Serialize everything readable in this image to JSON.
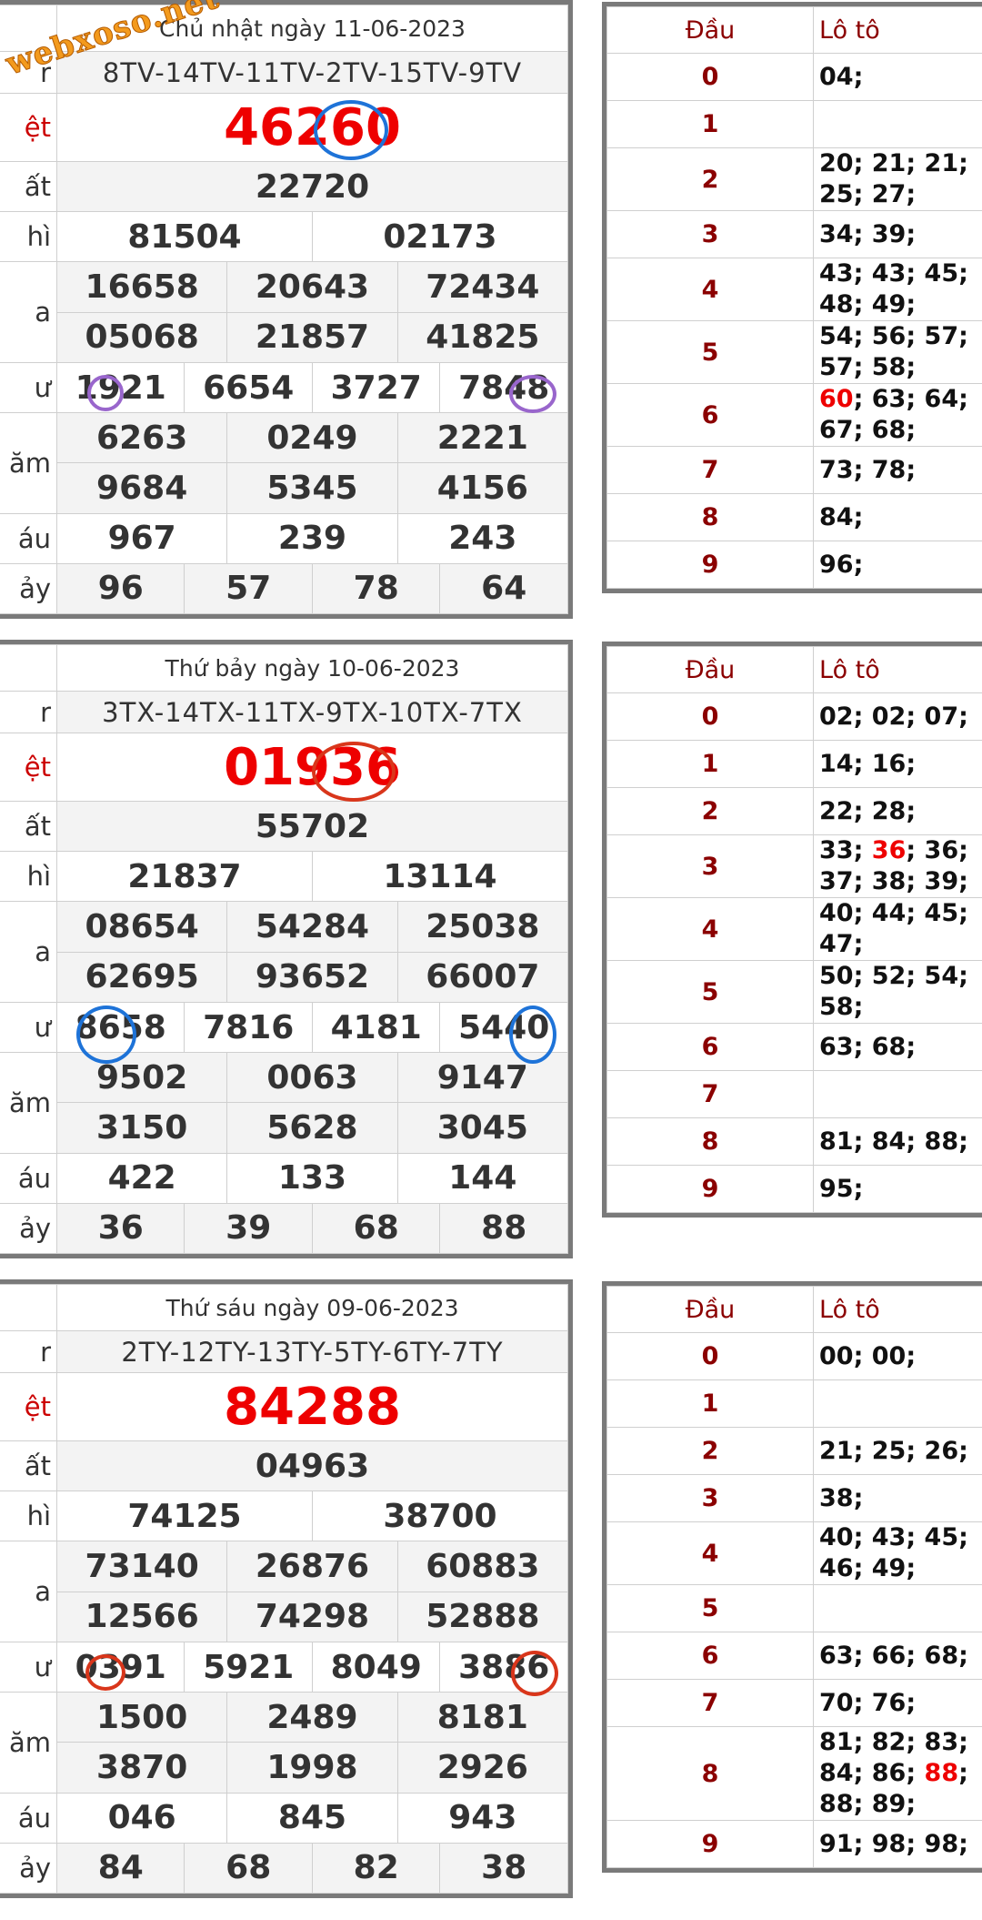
{
  "watermark": "webxoso.net",
  "draws": [
    {
      "date": "Chủ nhật ngày 11-06-2023",
      "labels": {
        "code": "r",
        "special": "ệt",
        "first": "ất",
        "second": "hì",
        "third": "a",
        "fourth": "ư",
        "fifth": "ăm",
        "sixth": "áu",
        "seventh": "ảy"
      },
      "code": "8TV-14TV-11TV-2TV-15TV-9TV",
      "special": "46260",
      "first": "22720",
      "second": [
        "81504",
        "02173"
      ],
      "third": [
        "16658",
        "20643",
        "72434",
        "05068",
        "21857",
        "41825"
      ],
      "fourth": [
        "1921",
        "6654",
        "3727",
        "7848"
      ],
      "fifth": [
        "6263",
        "0249",
        "2221",
        "9684",
        "5345",
        "4156"
      ],
      "sixth": [
        "967",
        "239",
        "243"
      ],
      "seventh": [
        "96",
        "57",
        "78",
        "64"
      ],
      "loto_header": {
        "dau": "Đầu",
        "loto": "Lô tô"
      },
      "loto": [
        {
          "d": "0",
          "v": "04;"
        },
        {
          "d": "1",
          "v": ""
        },
        {
          "d": "2",
          "v": "20; 21; 21; 25; 27;"
        },
        {
          "d": "3",
          "v": "34; 39;"
        },
        {
          "d": "4",
          "v": "43; 43; 45; 48; 49;"
        },
        {
          "d": "5",
          "v": "54; 56; 57; 57; 58;"
        },
        {
          "d": "6",
          "hl": "60",
          "v": "; 63; 64; 67; 68;"
        },
        {
          "d": "7",
          "v": "73; 78;"
        },
        {
          "d": "8",
          "v": "84;"
        },
        {
          "d": "9",
          "v": "96;"
        }
      ]
    },
    {
      "date": "Thứ bảy ngày 10-06-2023",
      "labels": {
        "code": "r",
        "special": "ệt",
        "first": "ất",
        "second": "hì",
        "third": "a",
        "fourth": "ư",
        "fifth": "ăm",
        "sixth": "áu",
        "seventh": "ảy"
      },
      "code": "3TX-14TX-11TX-9TX-10TX-7TX",
      "special": "01936",
      "first": "55702",
      "second": [
        "21837",
        "13114"
      ],
      "third": [
        "08654",
        "54284",
        "25038",
        "62695",
        "93652",
        "66007"
      ],
      "fourth": [
        "8658",
        "7816",
        "4181",
        "5440"
      ],
      "fifth": [
        "9502",
        "0063",
        "9147",
        "3150",
        "5628",
        "3045"
      ],
      "sixth": [
        "422",
        "133",
        "144"
      ],
      "seventh": [
        "36",
        "39",
        "68",
        "88"
      ],
      "loto_header": {
        "dau": "Đầu",
        "loto": "Lô tô"
      },
      "loto": [
        {
          "d": "0",
          "v": "02; 02; 07;"
        },
        {
          "d": "1",
          "v": "14; 16;"
        },
        {
          "d": "2",
          "v": "22; 28;"
        },
        {
          "d": "3",
          "pre": "33; ",
          "hl": "36",
          "v": "; 36; 37; 38; 39;"
        },
        {
          "d": "4",
          "v": "40; 44; 45; 47;"
        },
        {
          "d": "5",
          "v": "50; 52; 54; 58;"
        },
        {
          "d": "6",
          "v": "63; 68;"
        },
        {
          "d": "7",
          "v": ""
        },
        {
          "d": "8",
          "v": "81; 84; 88;"
        },
        {
          "d": "9",
          "v": "95;"
        }
      ]
    },
    {
      "date": "Thứ sáu ngày 09-06-2023",
      "labels": {
        "code": "r",
        "special": "ệt",
        "first": "ất",
        "second": "hì",
        "third": "a",
        "fourth": "ư",
        "fifth": "ăm",
        "sixth": "áu",
        "seventh": "ảy"
      },
      "code": "2TY-12TY-13TY-5TY-6TY-7TY",
      "special": "84288",
      "first": "04963",
      "second": [
        "74125",
        "38700"
      ],
      "third": [
        "73140",
        "26876",
        "60883",
        "12566",
        "74298",
        "52888"
      ],
      "fourth": [
        "0391",
        "5921",
        "8049",
        "3886"
      ],
      "fifth": [
        "1500",
        "2489",
        "8181",
        "3870",
        "1998",
        "2926"
      ],
      "sixth": [
        "046",
        "845",
        "943"
      ],
      "seventh": [
        "84",
        "68",
        "82",
        "38"
      ],
      "loto_header": {
        "dau": "Đầu",
        "loto": "Lô tô"
      },
      "loto": [
        {
          "d": "0",
          "v": "00; 00;"
        },
        {
          "d": "1",
          "v": ""
        },
        {
          "d": "2",
          "v": "21; 25; 26;"
        },
        {
          "d": "3",
          "v": "38;"
        },
        {
          "d": "4",
          "v": "40; 43; 45; 46; 49;"
        },
        {
          "d": "5",
          "v": ""
        },
        {
          "d": "6",
          "v": "63; 66; 68;"
        },
        {
          "d": "7",
          "v": "70; 76;"
        },
        {
          "d": "8",
          "pre": "81; 82; 83; 84; 86; ",
          "hl": "88",
          "v": "; 88; 89;"
        },
        {
          "d": "9",
          "v": "91; 98; 98;"
        }
      ]
    }
  ],
  "colors": {
    "special": "#e00000",
    "dau": "#8b0000",
    "circle_purple": "#9966cc",
    "circle_blue": "#1e73d8",
    "circle_red": "#d9361b"
  }
}
